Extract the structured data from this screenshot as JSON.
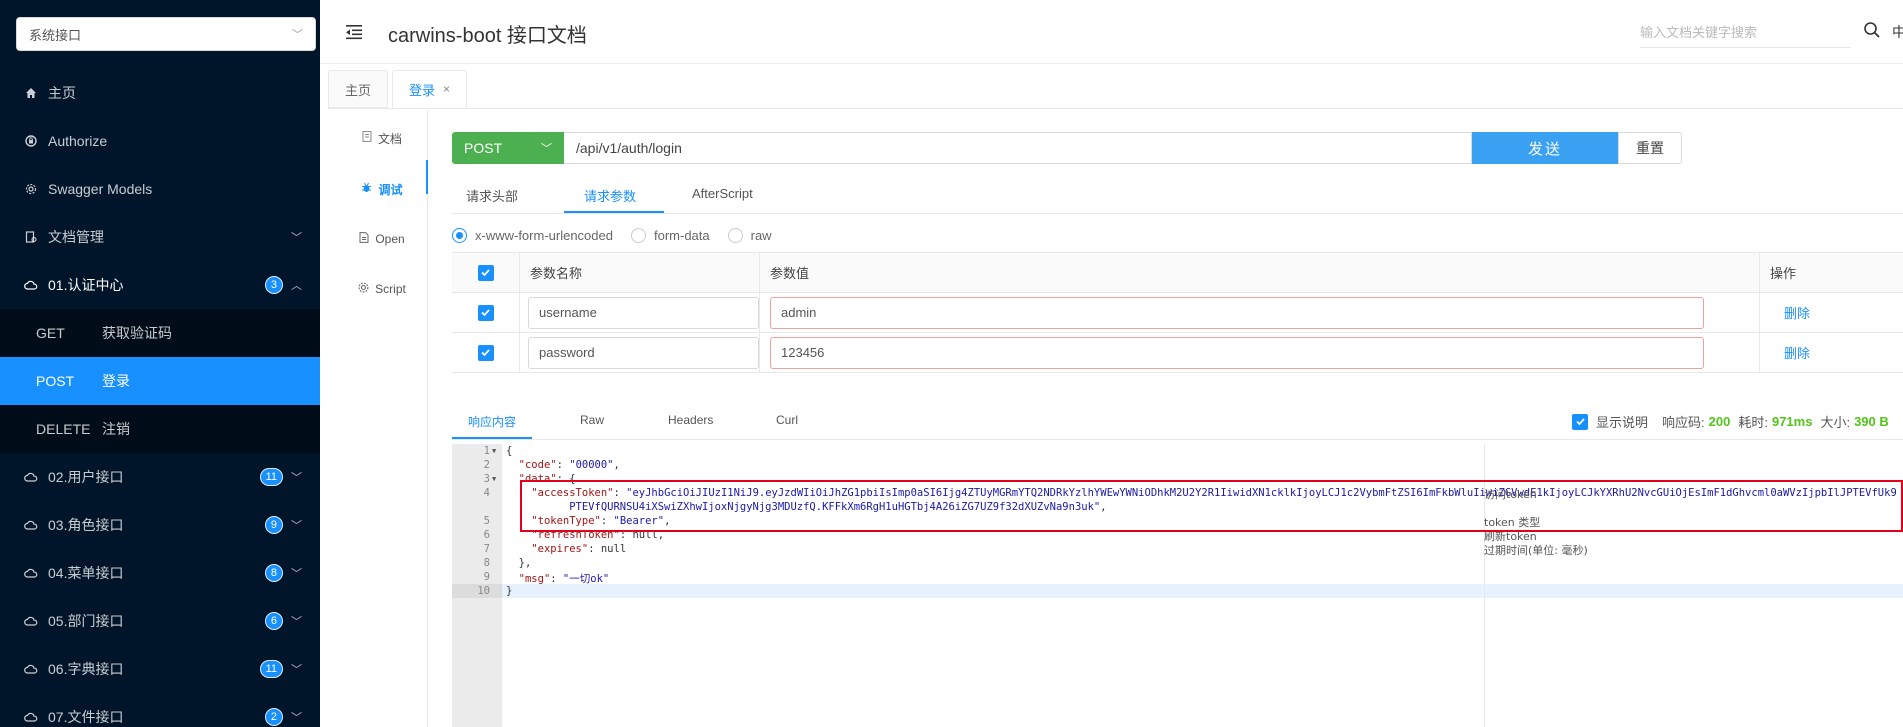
{
  "sidebar": {
    "group_select": "系统接口",
    "menu": [
      {
        "icon": "home-icon",
        "label": "主页"
      },
      {
        "icon": "lock-icon",
        "label": "Authorize"
      },
      {
        "icon": "gear-icon",
        "label": "Swagger Models"
      },
      {
        "icon": "doc-manage-icon",
        "label": "文档管理"
      }
    ],
    "auth_group": {
      "label": "01.认证中心",
      "count": "3"
    },
    "auth_items": [
      {
        "method": "GET",
        "label": "获取验证码"
      },
      {
        "method": "POST",
        "label": "登录"
      },
      {
        "method": "DELETE",
        "label": "注销"
      }
    ],
    "groups": [
      {
        "label": "02.用户接口",
        "count": "11"
      },
      {
        "label": "03.角色接口",
        "count": "9"
      },
      {
        "label": "04.菜单接口",
        "count": "8"
      },
      {
        "label": "05.部门接口",
        "count": "6"
      },
      {
        "label": "06.字典接口",
        "count": "11"
      },
      {
        "label": "07.文件接口",
        "count": "2"
      }
    ]
  },
  "header": {
    "title": "carwins-boot 接口文档",
    "search_placeholder": "输入文档关键字搜索",
    "lang": "中"
  },
  "tabs": [
    {
      "label": "主页"
    },
    {
      "label": "登录",
      "close": "×"
    }
  ],
  "vnav": [
    {
      "icon": "doc-icon",
      "label": "文档"
    },
    {
      "icon": "debug-icon",
      "label": "调试"
    },
    {
      "icon": "file-icon",
      "label": "Open"
    },
    {
      "icon": "script-icon",
      "label": "Script"
    }
  ],
  "request": {
    "method": "POST",
    "url": "/api/v1/auth/login",
    "send": "发送",
    "reset": "重置"
  },
  "req_tabs": [
    "请求头部",
    "请求参数",
    "AfterScript"
  ],
  "body_types": [
    "x-www-form-urlencoded",
    "form-data",
    "raw"
  ],
  "params": {
    "headers": {
      "name": "参数名称",
      "value": "参数值",
      "op": "操作"
    },
    "rows": [
      {
        "name": "username",
        "value": "admin",
        "op": "删除"
      },
      {
        "name": "password",
        "value": "123456",
        "op": "删除"
      }
    ]
  },
  "resp_tabs": [
    "响应内容",
    "Raw",
    "Headers",
    "Curl"
  ],
  "resp_meta": {
    "show_desc": "显示说明",
    "code_label": "响应码:",
    "code": "200",
    "time_label": "耗时:",
    "time": "971ms",
    "size_label": "大小:",
    "size": "390 B"
  },
  "code": {
    "line_numbers": [
      "1",
      "2",
      "3",
      "4",
      "",
      "5",
      "6",
      "7",
      "8",
      "9",
      "10"
    ],
    "l1": "{",
    "l2_key": "\"code\"",
    "l2_val": "\"00000\"",
    "l3_key": "\"data\"",
    "l4_key": "\"accessToken\"",
    "l4_val": "\"eyJhbGciOiJIUzI1NiJ9.eyJzdWIiOiJhZG1pbiIsImp0aSI6Ijg4ZTUyMGRmYTQ2NDRkYzlhYWEwYWNiODhkM2U2Y2R1IiwidXN1cklkIjoyLCJ1c2VybmFtZSI6ImFkbWluIiwiZGVwdE1kIjoyLCJkYXRhU2NvcGUiOjEsImF1dGhvcml0aWVzIjpbIlJPTEVfUk9PVCJdLCJleHAiOjE2OTg1MzM3OTJ9",
    "l4b_val": "PTEVfQURNSU4iXSwiZXhwIjoxNjgyNjg3MDUzfQ.KFFkXm6RgH1uHGTbj4A26iZG7UZ9f32dXUZvNa9n3uk\"",
    "l5_key": "\"tokenType\"",
    "l5_val": "\"Bearer\"",
    "l6_key": "\"refreshToken\"",
    "l6_val": "null",
    "l7_key": "\"expires\"",
    "l7_val": "null",
    "l8": "},",
    "l9_key": "\"msg\"",
    "l9_val": "\"一切ok\"",
    "l10": "}"
  },
  "comments": {
    "c4": "访问token",
    "c5": "token 类型",
    "c6": "刷新token",
    "c7": "过期时间(单位: 毫秒)"
  }
}
